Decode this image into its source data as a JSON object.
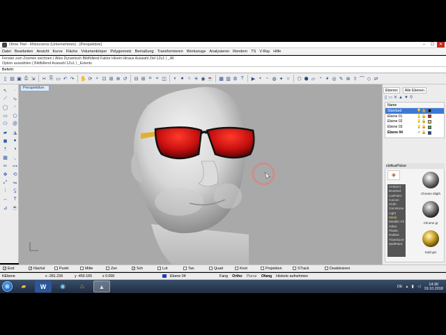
{
  "window": {
    "title": "Ohne Titel - Rhinoceros (Unternehmen) - [Perspektive]",
    "controls": [
      "–",
      "☐",
      "✕"
    ]
  },
  "menu": [
    "Datei",
    "Bearbeiten",
    "Ansicht",
    "Kurve",
    "Fläche",
    "Volumenkörper",
    "Polygonnetz",
    "Bemaßung",
    "Transformieren",
    "Werkzeuge",
    "Analysieren",
    "Rendern",
    "TS",
    "V-Ray",
    "Hilfe"
  ],
  "command_history": [
    "Fenster zum Zoomen zeichnen ( Alles Dynamisch Bildfüllend Faktor Hinein Hinaus Auswahl Ziel 1Zu1 ) _All",
    "Option auswählen ( Bildfüllend Auswahl 1Zu1 ) _Extents"
  ],
  "command_prompt": "Befehl:",
  "viewport": {
    "label": "Perspektive",
    "background": "#a9a9a9"
  },
  "layers": {
    "tabs": [
      "Ebenen",
      "Alle Ebenen"
    ],
    "column_name": "Name",
    "rows": [
      {
        "name": "Standard",
        "color": "#000000",
        "selected": true,
        "current": false
      },
      {
        "name": "Ebene 01",
        "color": "#e02020",
        "selected": false,
        "current": false
      },
      {
        "name": "Ebene 02",
        "color": "#f4d23a",
        "selected": false,
        "current": false
      },
      {
        "name": "Ebene 03",
        "color": "#2fb24a",
        "selected": false,
        "current": false
      },
      {
        "name": "Ebene 04",
        "color": "#1c3fbf",
        "selected": false,
        "current": true
      }
    ]
  },
  "materials": {
    "title": "ctrlAuxPicker",
    "categories": [
      "Ambient",
      "Brushed",
      "CarPaint",
      "Carvon",
      "Cloth",
      "Gemstone",
      "Light",
      "Metal",
      "Metallic Fla",
      "Other",
      "Plastic",
      "Rubber",
      "Translucen",
      "WallPaint"
    ],
    "highlighted": "Metal",
    "thumbnails": [
      {
        "label": "Chrome Sligth",
        "kind": "chrome"
      },
      {
        "label": "Chrome gr",
        "kind": "chrome-dark"
      },
      {
        "label": "Gold gre",
        "kind": "gold"
      }
    ]
  },
  "snaps": [
    {
      "label": "End",
      "checked": true
    },
    {
      "label": "Nächst",
      "checked": true
    },
    {
      "label": "Punkt",
      "checked": false
    },
    {
      "label": "Mitte",
      "checked": false
    },
    {
      "label": "Zen",
      "checked": false
    },
    {
      "label": "Sch",
      "checked": true
    },
    {
      "label": "Lot",
      "checked": false
    },
    {
      "label": "Tan",
      "checked": false
    },
    {
      "label": "Quad",
      "checked": false
    },
    {
      "label": "Knot",
      "checked": false
    },
    {
      "label": "Projektion",
      "checked": false
    },
    {
      "label": "STrack",
      "checked": false
    },
    {
      "label": "Deaktivieren",
      "checked": false
    }
  ],
  "status": {
    "cplane": "KEbene",
    "x": "x -281.239",
    "y": "y -450.165",
    "z": "z 0.000",
    "layer": "Ebene 04",
    "layer_color": "#1c3fbf",
    "toggles": [
      "Fang",
      "Ortho",
      "Planar",
      "Ofang",
      "Historie aufnehmen"
    ],
    "bold_toggle": "Ofang"
  },
  "taskbar": {
    "apps": [
      {
        "name": "explorer",
        "glyph": "📁"
      },
      {
        "name": "word",
        "glyph": "W"
      },
      {
        "name": "browser",
        "glyph": "◉"
      },
      {
        "name": "flame",
        "glyph": "♨"
      },
      {
        "name": "rhino",
        "glyph": "🦏"
      }
    ],
    "lang": "DE",
    "time": "14:30",
    "date": "19.10.2018"
  }
}
